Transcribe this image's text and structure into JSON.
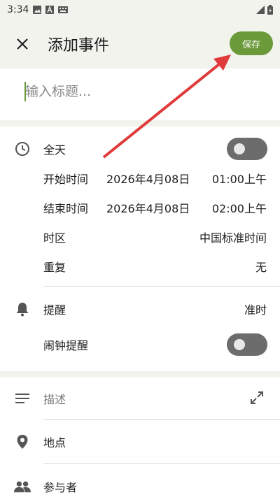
{
  "status_bar": {
    "time": "3:34"
  },
  "header": {
    "title": "添加事件",
    "save_label": "保存"
  },
  "title_input": {
    "placeholder": "输入标题..."
  },
  "all_day": {
    "label": "全天"
  },
  "start": {
    "label": "开始时间",
    "date": "2026年4月08日",
    "time": "01:00上午"
  },
  "end": {
    "label": "结束时间",
    "date": "2026年4月08日",
    "time": "02:00上午"
  },
  "timezone": {
    "label": "时区",
    "value": "中国标准时间"
  },
  "repeat": {
    "label": "重复",
    "value": "无"
  },
  "reminder": {
    "label": "提醒",
    "value": "准时"
  },
  "alarm": {
    "label": "闹钟提醒"
  },
  "description": {
    "placeholder": "描述"
  },
  "location": {
    "label": "地点"
  },
  "attendees": {
    "label": "参与者"
  },
  "colors": {
    "accent": "#6a9a3a",
    "annotation_arrow": "#e03a3a"
  }
}
